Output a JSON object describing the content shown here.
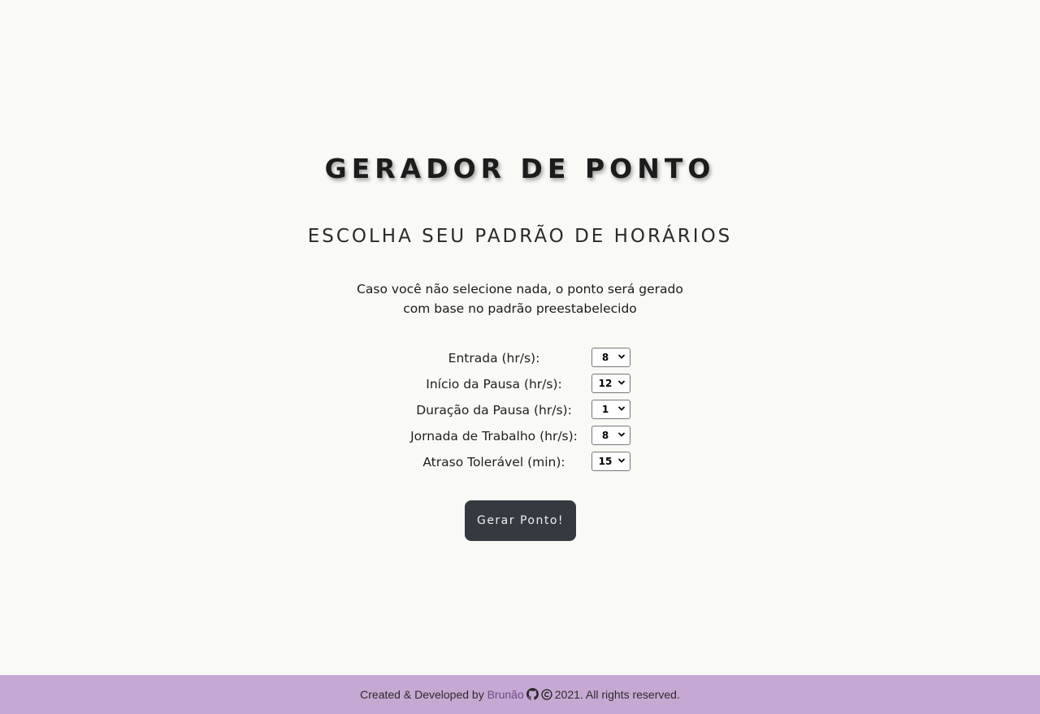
{
  "header": {
    "title": "GERADOR DE PONTO",
    "subtitle": "ESCOLHA SEU PADRÃO DE HORÁRIOS"
  },
  "note": {
    "line1": "Caso você não selecione nada, o ponto será gerado",
    "line2": "com base no padrão preestabelecido"
  },
  "form": {
    "fields": [
      {
        "label": "Entrada (hr/s):",
        "value": "8"
      },
      {
        "label": "Início da Pausa (hr/s):",
        "value": "12"
      },
      {
        "label": "Duração da Pausa (hr/s):",
        "value": "1"
      },
      {
        "label": "Jornada de Trabalho (hr/s):",
        "value": "8"
      },
      {
        "label": "Atraso Tolerável (min):",
        "value": "15"
      }
    ],
    "submit_label": "Gerar Ponto!"
  },
  "footer": {
    "prefix": "Created & Developed by",
    "author": "Brunão",
    "github_icon": "github-icon",
    "copyright_icon": "copyright-icon",
    "suffix": "2021. All rights reserved."
  },
  "colors": {
    "background": "#f9f9f6",
    "button": "#343a40",
    "footer": "#c6a9d3",
    "author_link": "#6b4d80"
  }
}
